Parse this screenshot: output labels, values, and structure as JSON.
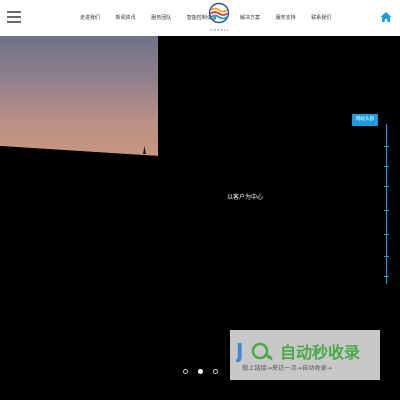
{
  "header": {
    "nav_left": [
      "走进我们",
      "新闻资讯",
      "服务团队",
      "智能控制设备"
    ],
    "nav_right": [
      "解决方案",
      "服务支持",
      "联系我们"
    ],
    "logo_text": "GORELL"
  },
  "hero": {
    "slogan": "以客户为中心"
  },
  "timeline": {
    "tag": "网站头部"
  },
  "carousel": {
    "slide_count": 3,
    "active_index": 1
  },
  "watermark": {
    "main": "自动秒收录",
    "sub": "做上链接→来访一次→自动收录→"
  },
  "colors": {
    "accent": "#1a9ee0",
    "background": "#000000"
  }
}
